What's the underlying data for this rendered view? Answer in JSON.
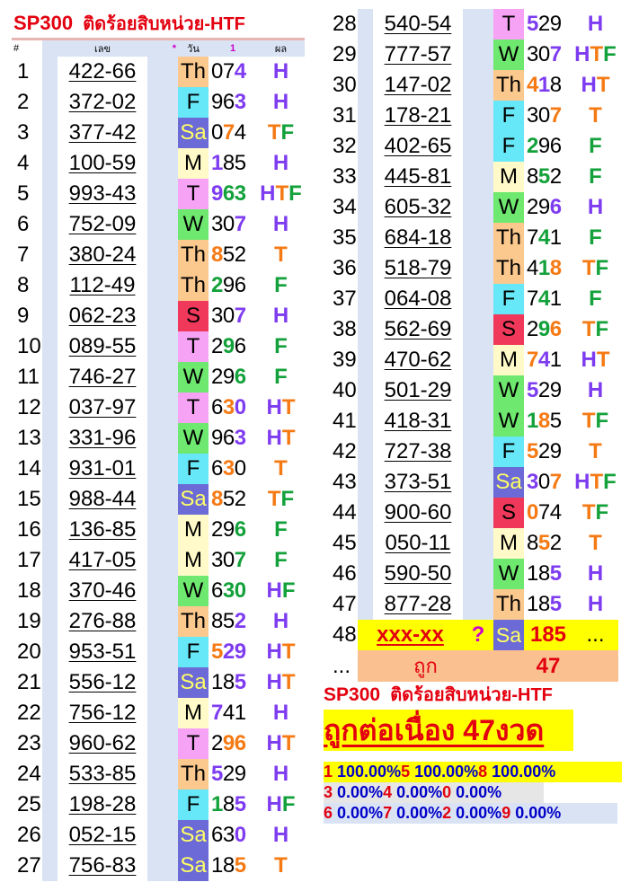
{
  "header": {
    "brand": "SP300",
    "subtitle": "ติดร้อยสิบหน่วย-HTF",
    "col_num": "#",
    "col_code": "เลข",
    "col_star": "*",
    "col_day": "วัน",
    "col_one": "1",
    "col_result": "ผล"
  },
  "colors": {
    "H": "#7e3cf0",
    "T": "#f57a14",
    "F": "#12a13a",
    "title_red": "#e3000f",
    "stat_blue": "#0000c8"
  },
  "rows": [
    {
      "n": "1",
      "code": "422-66",
      "day": "Th",
      "res": [
        [
          "0",
          ""
        ],
        [
          "7",
          ""
        ],
        [
          "4",
          "H"
        ]
      ],
      "htf": [
        [
          "H",
          "H"
        ]
      ]
    },
    {
      "n": "2",
      "code": "372-02",
      "day": "F",
      "res": [
        [
          "9",
          ""
        ],
        [
          "6",
          ""
        ],
        [
          "3",
          "H"
        ]
      ],
      "htf": [
        [
          "H",
          "H"
        ]
      ]
    },
    {
      "n": "3",
      "code": "377-42",
      "day": "Sa",
      "res": [
        [
          "0",
          ""
        ],
        [
          "7",
          "T"
        ],
        [
          "4",
          ""
        ]
      ],
      "htf": [
        [
          "T",
          "T"
        ],
        [
          "F",
          "F"
        ]
      ]
    },
    {
      "n": "4",
      "code": "100-59",
      "day": "M",
      "res": [
        [
          "1",
          "H"
        ],
        [
          "8",
          ""
        ],
        [
          "5",
          ""
        ]
      ],
      "htf": [
        [
          "H",
          "H"
        ]
      ]
    },
    {
      "n": "5",
      "code": "993-43",
      "day": "T",
      "res": [
        [
          "9",
          "H"
        ],
        [
          "6",
          "F"
        ],
        [
          "3",
          "F"
        ]
      ],
      "htf": [
        [
          "H",
          "H"
        ],
        [
          "T",
          "T"
        ],
        [
          "F",
          "F"
        ]
      ]
    },
    {
      "n": "6",
      "code": "752-09",
      "day": "W",
      "res": [
        [
          "3",
          ""
        ],
        [
          "0",
          ""
        ],
        [
          "7",
          "H"
        ]
      ],
      "htf": [
        [
          "H",
          "H"
        ]
      ]
    },
    {
      "n": "7",
      "code": "380-24",
      "day": "Th",
      "res": [
        [
          "8",
          "T"
        ],
        [
          "5",
          ""
        ],
        [
          "2",
          ""
        ]
      ],
      "htf": [
        [
          "T",
          "T"
        ]
      ]
    },
    {
      "n": "8",
      "code": "112-49",
      "day": "Th",
      "res": [
        [
          "2",
          "F"
        ],
        [
          "9",
          ""
        ],
        [
          "6",
          ""
        ]
      ],
      "htf": [
        [
          "F",
          "F"
        ]
      ]
    },
    {
      "n": "9",
      "code": "062-23",
      "day": "S",
      "res": [
        [
          "3",
          ""
        ],
        [
          "0",
          ""
        ],
        [
          "7",
          "H"
        ]
      ],
      "htf": [
        [
          "H",
          "H"
        ]
      ]
    },
    {
      "n": "10",
      "code": "089-55",
      "day": "T",
      "res": [
        [
          "2",
          ""
        ],
        [
          "9",
          "F"
        ],
        [
          "6",
          ""
        ]
      ],
      "htf": [
        [
          "F",
          "F"
        ]
      ]
    },
    {
      "n": "11",
      "code": "746-27",
      "day": "W",
      "res": [
        [
          "2",
          ""
        ],
        [
          "9",
          ""
        ],
        [
          "6",
          "F"
        ]
      ],
      "htf": [
        [
          "F",
          "F"
        ]
      ]
    },
    {
      "n": "12",
      "code": "037-97",
      "day": "T",
      "res": [
        [
          "6",
          ""
        ],
        [
          "3",
          "T"
        ],
        [
          "0",
          "H"
        ]
      ],
      "htf": [
        [
          "H",
          "H"
        ],
        [
          "T",
          "T"
        ]
      ]
    },
    {
      "n": "13",
      "code": "331-96",
      "day": "W",
      "res": [
        [
          "9",
          ""
        ],
        [
          "6",
          ""
        ],
        [
          "3",
          "H"
        ]
      ],
      "htf": [
        [
          "H",
          "H"
        ],
        [
          "T",
          "T"
        ]
      ]
    },
    {
      "n": "14",
      "code": "931-01",
      "day": "F",
      "res": [
        [
          "6",
          ""
        ],
        [
          "3",
          "T"
        ],
        [
          "0",
          ""
        ]
      ],
      "htf": [
        [
          "T",
          "T"
        ]
      ]
    },
    {
      "n": "15",
      "code": "988-44",
      "day": "Sa",
      "res": [
        [
          "8",
          "T"
        ],
        [
          "5",
          ""
        ],
        [
          "2",
          ""
        ]
      ],
      "htf": [
        [
          "T",
          "T"
        ],
        [
          "F",
          "F"
        ]
      ]
    },
    {
      "n": "16",
      "code": "136-85",
      "day": "M",
      "res": [
        [
          "2",
          ""
        ],
        [
          "9",
          ""
        ],
        [
          "6",
          "F"
        ]
      ],
      "htf": [
        [
          "F",
          "F"
        ]
      ]
    },
    {
      "n": "17",
      "code": "417-05",
      "day": "M",
      "res": [
        [
          "3",
          ""
        ],
        [
          "0",
          ""
        ],
        [
          "7",
          "F"
        ]
      ],
      "htf": [
        [
          "F",
          "F"
        ]
      ]
    },
    {
      "n": "18",
      "code": "370-46",
      "day": "W",
      "res": [
        [
          "6",
          ""
        ],
        [
          "3",
          "F"
        ],
        [
          "0",
          "F"
        ]
      ],
      "htf": [
        [
          "H",
          "H"
        ],
        [
          "F",
          "F"
        ]
      ]
    },
    {
      "n": "19",
      "code": "276-88",
      "day": "Th",
      "res": [
        [
          "8",
          ""
        ],
        [
          "5",
          ""
        ],
        [
          "2",
          "H"
        ]
      ],
      "htf": [
        [
          "H",
          "H"
        ]
      ]
    },
    {
      "n": "20",
      "code": "953-51",
      "day": "F",
      "res": [
        [
          "5",
          "T"
        ],
        [
          "2",
          "H"
        ],
        [
          "9",
          "H"
        ]
      ],
      "htf": [
        [
          "H",
          "H"
        ],
        [
          "T",
          "T"
        ]
      ]
    },
    {
      "n": "21",
      "code": "556-12",
      "day": "Sa",
      "res": [
        [
          "1",
          ""
        ],
        [
          "8",
          ""
        ],
        [
          "5",
          "H"
        ]
      ],
      "htf": [
        [
          "H",
          "H"
        ],
        [
          "T",
          "T"
        ]
      ]
    },
    {
      "n": "22",
      "code": "756-12",
      "day": "M",
      "res": [
        [
          "7",
          "H"
        ],
        [
          "4",
          ""
        ],
        [
          "1",
          ""
        ]
      ],
      "htf": [
        [
          "H",
          "H"
        ]
      ]
    },
    {
      "n": "23",
      "code": "960-62",
      "day": "T",
      "res": [
        [
          "2",
          ""
        ],
        [
          "9",
          "T"
        ],
        [
          "6",
          "T"
        ]
      ],
      "htf": [
        [
          "H",
          "H"
        ],
        [
          "T",
          "T"
        ]
      ]
    },
    {
      "n": "24",
      "code": "533-85",
      "day": "Th",
      "res": [
        [
          "5",
          "H"
        ],
        [
          "2",
          ""
        ],
        [
          "9",
          ""
        ]
      ],
      "htf": [
        [
          "H",
          "H"
        ]
      ]
    },
    {
      "n": "25",
      "code": "198-28",
      "day": "F",
      "res": [
        [
          "1",
          "F"
        ],
        [
          "8",
          ""
        ],
        [
          "5",
          "H"
        ]
      ],
      "htf": [
        [
          "H",
          "H"
        ],
        [
          "F",
          "F"
        ]
      ]
    },
    {
      "n": "26",
      "code": "052-15",
      "day": "Sa",
      "res": [
        [
          "6",
          ""
        ],
        [
          "3",
          ""
        ],
        [
          "0",
          "H"
        ]
      ],
      "htf": [
        [
          "H",
          "H"
        ]
      ]
    },
    {
      "n": "27",
      "code": "756-83",
      "day": "Sa",
      "res": [
        [
          "1",
          ""
        ],
        [
          "8",
          ""
        ],
        [
          "5",
          "T"
        ]
      ],
      "htf": [
        [
          "T",
          "T"
        ]
      ]
    },
    {
      "n": "28",
      "code": "540-54",
      "day": "T",
      "res": [
        [
          "5",
          "H"
        ],
        [
          "2",
          ""
        ],
        [
          "9",
          ""
        ]
      ],
      "htf": [
        [
          "H",
          "H"
        ]
      ]
    },
    {
      "n": "29",
      "code": "777-57",
      "day": "W",
      "res": [
        [
          "3",
          ""
        ],
        [
          "0",
          ""
        ],
        [
          "7",
          "H"
        ]
      ],
      "htf": [
        [
          "H",
          "H"
        ],
        [
          "T",
          "T"
        ],
        [
          "F",
          "F"
        ]
      ]
    },
    {
      "n": "30",
      "code": "147-02",
      "day": "Th",
      "res": [
        [
          "4",
          "T"
        ],
        [
          "1",
          "H"
        ],
        [
          "8",
          ""
        ]
      ],
      "htf": [
        [
          "H",
          "H"
        ],
        [
          "T",
          "T"
        ]
      ]
    },
    {
      "n": "31",
      "code": "178-21",
      "day": "F",
      "res": [
        [
          "3",
          ""
        ],
        [
          "0",
          ""
        ],
        [
          "7",
          "T"
        ]
      ],
      "htf": [
        [
          "T",
          "T"
        ]
      ]
    },
    {
      "n": "32",
      "code": "402-65",
      "day": "F",
      "res": [
        [
          "2",
          "F"
        ],
        [
          "9",
          ""
        ],
        [
          "6",
          ""
        ]
      ],
      "htf": [
        [
          "F",
          "F"
        ]
      ]
    },
    {
      "n": "33",
      "code": "445-81",
      "day": "M",
      "res": [
        [
          "8",
          ""
        ],
        [
          "5",
          "F"
        ],
        [
          "2",
          ""
        ]
      ],
      "htf": [
        [
          "F",
          "F"
        ]
      ]
    },
    {
      "n": "34",
      "code": "605-32",
      "day": "W",
      "res": [
        [
          "2",
          ""
        ],
        [
          "9",
          ""
        ],
        [
          "6",
          "H"
        ]
      ],
      "htf": [
        [
          "H",
          "H"
        ]
      ]
    },
    {
      "n": "35",
      "code": "684-18",
      "day": "Th",
      "res": [
        [
          "7",
          ""
        ],
        [
          "4",
          "F"
        ],
        [
          "1",
          ""
        ]
      ],
      "htf": [
        [
          "F",
          "F"
        ]
      ]
    },
    {
      "n": "36",
      "code": "518-79",
      "day": "Th",
      "res": [
        [
          "4",
          ""
        ],
        [
          "1",
          "F"
        ],
        [
          "8",
          "T"
        ]
      ],
      "htf": [
        [
          "T",
          "T"
        ],
        [
          "F",
          "F"
        ]
      ]
    },
    {
      "n": "37",
      "code": "064-08",
      "day": "F",
      "res": [
        [
          "7",
          ""
        ],
        [
          "4",
          "F"
        ],
        [
          "1",
          ""
        ]
      ],
      "htf": [
        [
          "F",
          "F"
        ]
      ]
    },
    {
      "n": "38",
      "code": "562-69",
      "day": "S",
      "res": [
        [
          "2",
          ""
        ],
        [
          "9",
          "F"
        ],
        [
          "6",
          "T"
        ]
      ],
      "htf": [
        [
          "T",
          "T"
        ],
        [
          "F",
          "F"
        ]
      ]
    },
    {
      "n": "39",
      "code": "470-62",
      "day": "M",
      "res": [
        [
          "7",
          "T"
        ],
        [
          "4",
          "H"
        ],
        [
          "1",
          ""
        ]
      ],
      "htf": [
        [
          "H",
          "H"
        ],
        [
          "T",
          "T"
        ]
      ]
    },
    {
      "n": "40",
      "code": "501-29",
      "day": "W",
      "res": [
        [
          "5",
          "H"
        ],
        [
          "2",
          ""
        ],
        [
          "9",
          ""
        ]
      ],
      "htf": [
        [
          "H",
          "H"
        ]
      ]
    },
    {
      "n": "41",
      "code": "418-31",
      "day": "W",
      "res": [
        [
          "1",
          "F"
        ],
        [
          "8",
          "T"
        ],
        [
          "5",
          ""
        ]
      ],
      "htf": [
        [
          "T",
          "T"
        ],
        [
          "F",
          "F"
        ]
      ]
    },
    {
      "n": "42",
      "code": "727-38",
      "day": "F",
      "res": [
        [
          "5",
          "T"
        ],
        [
          "2",
          ""
        ],
        [
          "9",
          ""
        ]
      ],
      "htf": [
        [
          "T",
          "T"
        ]
      ]
    },
    {
      "n": "43",
      "code": "373-51",
      "day": "Sa",
      "res": [
        [
          "3",
          "H"
        ],
        [
          "0",
          ""
        ],
        [
          "7",
          "T"
        ]
      ],
      "htf": [
        [
          "H",
          "H"
        ],
        [
          "T",
          "T"
        ],
        [
          "F",
          "F"
        ]
      ]
    },
    {
      "n": "44",
      "code": "900-60",
      "day": "S",
      "res": [
        [
          "0",
          "T"
        ],
        [
          "7",
          ""
        ],
        [
          "4",
          ""
        ]
      ],
      "htf": [
        [
          "T",
          "T"
        ],
        [
          "F",
          "F"
        ]
      ]
    },
    {
      "n": "45",
      "code": "050-11",
      "day": "M",
      "res": [
        [
          "8",
          ""
        ],
        [
          "5",
          "T"
        ],
        [
          "2",
          ""
        ]
      ],
      "htf": [
        [
          "T",
          "T"
        ]
      ]
    },
    {
      "n": "46",
      "code": "590-50",
      "day": "W",
      "res": [
        [
          "1",
          ""
        ],
        [
          "8",
          ""
        ],
        [
          "5",
          "H"
        ]
      ],
      "htf": [
        [
          "H",
          "H"
        ]
      ]
    },
    {
      "n": "47",
      "code": "877-28",
      "day": "Th",
      "res": [
        [
          "1",
          ""
        ],
        [
          "8",
          ""
        ],
        [
          "5",
          "H"
        ]
      ],
      "htf": [
        [
          "H",
          "H"
        ]
      ]
    }
  ],
  "pending": {
    "n": "48",
    "code": "xxx-xx",
    "mark": "?",
    "day": "Sa",
    "value": "185",
    "result": "..."
  },
  "summary_row": {
    "n": "...",
    "label": "ถูก",
    "value": "47"
  },
  "summary": {
    "brand": "SP300",
    "subtitle": "ติดร้อยสิบหน่วย-HTF",
    "streak": "ถูกต่อเนื่อง 47งวด",
    "stats": [
      [
        [
          "1",
          "100.00%"
        ],
        [
          "5",
          "100.00%"
        ],
        [
          "8",
          "100.00%"
        ]
      ],
      [
        [
          "3",
          "0.00%"
        ],
        [
          "4",
          "0.00%"
        ],
        [
          "0",
          "0.00%"
        ]
      ],
      [
        [
          "6",
          "0.00%"
        ],
        [
          "7",
          "0.00%"
        ],
        [
          "2",
          "0.00%"
        ],
        [
          "9",
          "0.00%"
        ]
      ]
    ]
  }
}
